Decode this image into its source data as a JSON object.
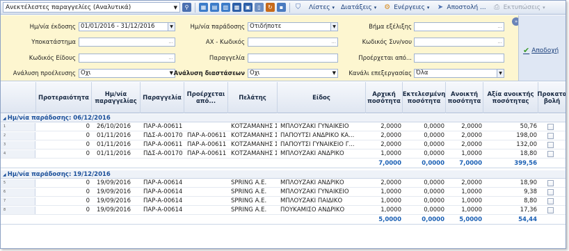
{
  "toolbar": {
    "view_select": "Ανεκτέλεστες παραγγελίες (Αναλυτικά)",
    "menus": [
      {
        "label": "Λίστες",
        "caret": "▾",
        "enabled": true
      },
      {
        "label": "Διατάξεις",
        "caret": "▾",
        "enabled": true
      },
      {
        "label": "Ενέργειες",
        "caret": "▾",
        "enabled": true
      },
      {
        "label": "Αποστολή ...",
        "caret": "",
        "enabled": true
      },
      {
        "label": "Εκτυπώσεις",
        "caret": "▾",
        "enabled": false
      }
    ]
  },
  "filters": {
    "issue_date_label": "Ημ/νία έκδοσης",
    "issue_date_value": "01/01/2016 - 31/12/2016",
    "delivery_date_label": "Ημ/νία παράδοσης",
    "delivery_date_value": "Οτιδήποτε",
    "step_label": "Βήμα εξέλιξης",
    "step_value": "",
    "branch_label": "Υποκατάστημα",
    "branch_value": "",
    "ax_code_label": "ΑΧ - Κωδικός",
    "ax_code_value": "",
    "partner_code_label": "Κωδικός Συν/νου",
    "partner_code_value": "",
    "item_code_label": "Κωδικός Είδους",
    "item_code_value": "",
    "order_label": "Παραγγελία",
    "order_value": "",
    "origin_label": "Προέρχεται από...",
    "origin_value": "",
    "origin_analysis_label": "Ανάλυση προέλευσης",
    "origin_analysis_value": "Οχι",
    "dimension_analysis_label": "Ανάλυση διαστάσεων",
    "dimension_analysis_value": "Οχι",
    "channel_label": "Κανάλι επεξεργασίας",
    "channel_value": "Όλα",
    "accept_label": "Αποδοχή",
    "ellipsis": "...",
    "collapse_icon": "»"
  },
  "columns": [
    "Προτεραιότητα",
    "Ημ/νία παραγγελίας",
    "Παραγγελία",
    "Προέρχεται από...",
    "Πελάτης",
    "Είδος",
    "Αρχική ποσότητα",
    "Εκτελεσμένη ποσότητα",
    "Ανοικτή ποσότητα",
    "Αξία ανοικτής ποσότητας",
    "Προκατα βολή"
  ],
  "groups": [
    {
      "label": "Ημ/νία παράδοσης: 06/12/2016",
      "rows": [
        {
          "num": "1",
          "priority": "0",
          "date": "26/10/2016",
          "order": "ΠΑΡ-Α-00611",
          "from": "",
          "customer": "ΚΟΤΖΑΜΑΝΗΣ Σ...",
          "item": "ΜΠΛΟΥΖΑΚΙ ΓΥΝΑΙΚΕΙΟ",
          "initial": "2,0000",
          "executed": "0,0000",
          "open": "2,0000",
          "value": "50,76"
        },
        {
          "num": "2",
          "priority": "0",
          "date": "01/11/2016",
          "order": "ΠΔΣ-Α-00170",
          "from": "ΠΑΡ-Α-00611",
          "customer": "ΚΟΤΖΑΜΑΝΗΣ Σ...",
          "item": "ΠΑΠΟΥΤΣΙ ΑΝΔΡΙΚΟ ΚΑ...",
          "initial": "2,0000",
          "executed": "0,0000",
          "open": "2,0000",
          "value": "198,00"
        },
        {
          "num": "3",
          "priority": "0",
          "date": "01/11/2016",
          "order": "ΠΑΡ-Α-00611",
          "from": "ΠΑΡ-Α-00611",
          "customer": "ΚΟΤΖΑΜΑΝΗΣ Σ...",
          "item": "ΠΑΠΟΥΤΣΙ ΓΥΝΑΙΚΕΙΟ Γ...",
          "initial": "2,0000",
          "executed": "0,0000",
          "open": "2,0000",
          "value": "132,00"
        },
        {
          "num": "4",
          "priority": "0",
          "date": "01/11/2016",
          "order": "ΠΔΣ-Α-00170",
          "from": "ΠΑΡ-Α-00611",
          "customer": "ΚΟΤΖΑΜΑΝΗΣ Σ...",
          "item": "ΜΠΛΟΥΖΑΚΙ ΑΝΔΡΙΚΟ",
          "initial": "1,0000",
          "executed": "0,0000",
          "open": "1,0000",
          "value": "18,80"
        }
      ],
      "totals": {
        "initial": "7,0000",
        "executed": "0,0000",
        "open": "7,0000",
        "value": "399,56"
      }
    },
    {
      "label": "Ημ/νία παράδοσης: 19/12/2016",
      "rows": [
        {
          "num": "5",
          "priority": "0",
          "date": "19/09/2016",
          "order": "ΠΑΡ-Α-00614",
          "from": "",
          "customer": "SPRING Α.Ε.",
          "item": "ΜΠΛΟΥΖΑΚΙ ΑΝΔΡΙΚΟ",
          "initial": "2,0000",
          "executed": "0,0000",
          "open": "2,0000",
          "value": "18,90"
        },
        {
          "num": "6",
          "priority": "0",
          "date": "19/09/2016",
          "order": "ΠΑΡ-Α-00614",
          "from": "",
          "customer": "SPRING Α.Ε.",
          "item": "ΜΠΛΟΥΖΑΚΙ ΓΥΝΑΙΚΕΙΟ",
          "initial": "1,0000",
          "executed": "0,0000",
          "open": "1,0000",
          "value": "9,38"
        },
        {
          "num": "7",
          "priority": "0",
          "date": "19/09/2016",
          "order": "ΠΑΡ-Α-00614",
          "from": "",
          "customer": "SPRING Α.Ε.",
          "item": "ΜΠΛΟΥΖΑΚΙ ΠΑΙΔΙΚΟ",
          "initial": "1,0000",
          "executed": "0,0000",
          "open": "1,0000",
          "value": "8,80"
        },
        {
          "num": "8",
          "priority": "0",
          "date": "19/09/2016",
          "order": "ΠΑΡ-Α-00614",
          "from": "",
          "customer": "SPRING Α.Ε.",
          "item": "ΠΟΥΚΑΜΙΣΟ ΑΝΔΡΙΚΟ",
          "initial": "1,0000",
          "executed": "0,0000",
          "open": "1,0000",
          "value": "17,36"
        }
      ],
      "totals": {
        "initial": "5,0000",
        "executed": "0,0000",
        "open": "5,0000",
        "value": "54,44"
      }
    }
  ],
  "colors": {
    "accent": "#1a4f9a",
    "totals": "#1a5fb4",
    "filter_bg": "#fdf6d0"
  }
}
